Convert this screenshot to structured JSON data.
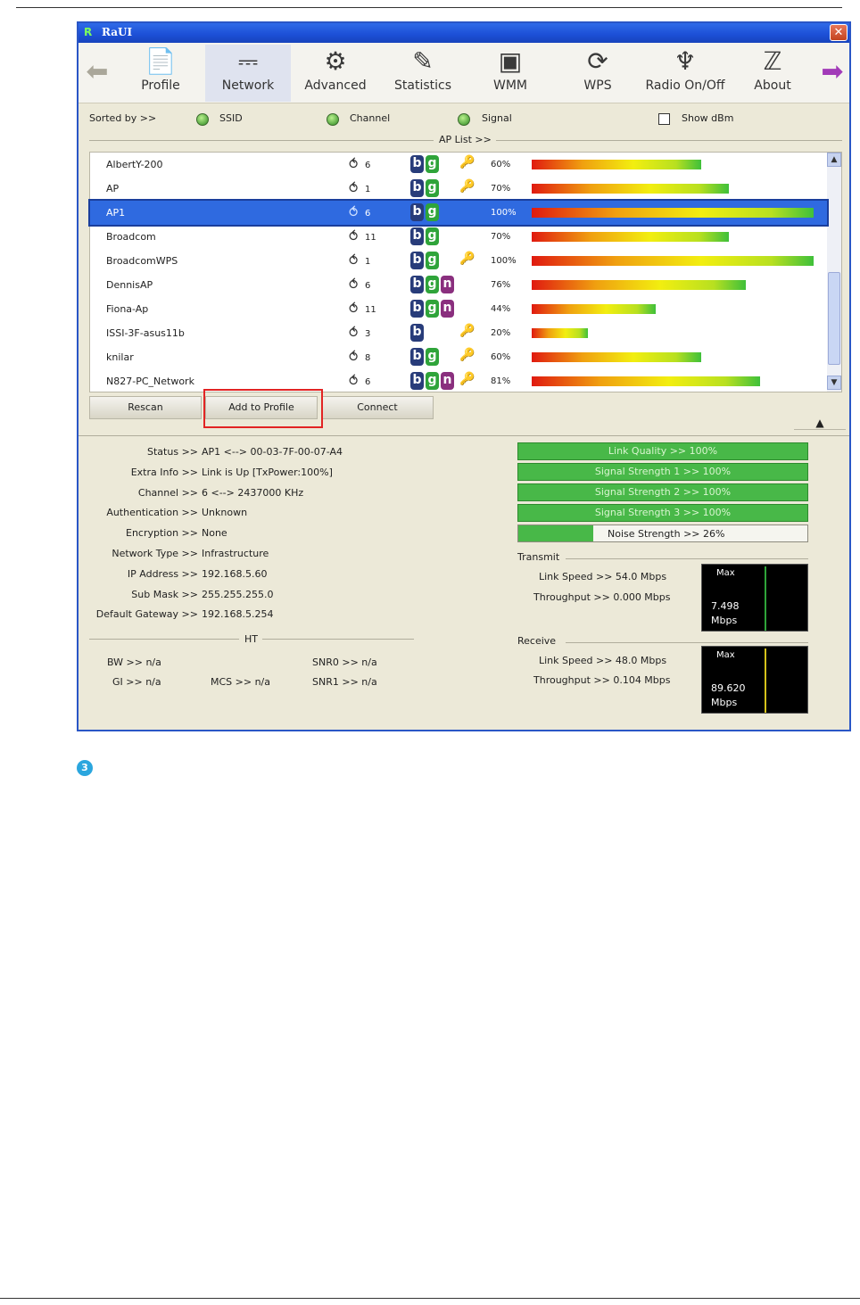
{
  "window": {
    "logo": "R",
    "title": "RaUI",
    "close": "✕"
  },
  "toolbar": {
    "back": "⬅",
    "forward": "➡",
    "items": [
      {
        "label": "Profile",
        "icon": "profile-icon",
        "glyph": "📄",
        "active": false
      },
      {
        "label": "Network",
        "icon": "router-icon",
        "glyph": "⎓",
        "active": true
      },
      {
        "label": "Advanced",
        "icon": "gears-icon",
        "glyph": "⚙",
        "active": false
      },
      {
        "label": "Statistics",
        "icon": "statistics-icon",
        "glyph": "✎",
        "active": false
      },
      {
        "label": "WMM",
        "icon": "wmm-icon",
        "glyph": "▣",
        "active": false
      },
      {
        "label": "WPS",
        "icon": "wps-icon",
        "glyph": "⟳",
        "active": false
      },
      {
        "label": "Radio On/Off",
        "icon": "radio-icon",
        "glyph": "♆",
        "active": false
      },
      {
        "label": "About",
        "icon": "about-icon",
        "glyph": "ℤ",
        "active": false
      }
    ]
  },
  "sort": {
    "label": "Sorted by >>",
    "ssid": "SSID",
    "channel": "Channel",
    "signal": "Signal",
    "show_dbm": "Show dBm",
    "ap_list": "AP List >>"
  },
  "ap_list": [
    {
      "ssid": "AlbertY-200",
      "channel": "6",
      "b": true,
      "g": true,
      "n": false,
      "secured": true,
      "signal": "60%",
      "level": 0.6
    },
    {
      "ssid": "AP",
      "channel": "1",
      "b": true,
      "g": true,
      "n": false,
      "secured": true,
      "signal": "70%",
      "level": 0.7
    },
    {
      "ssid": "AP1",
      "channel": "6",
      "b": true,
      "g": true,
      "n": false,
      "secured": false,
      "signal": "100%",
      "level": 1.0,
      "selected": true
    },
    {
      "ssid": "Broadcom",
      "channel": "11",
      "b": true,
      "g": true,
      "n": false,
      "secured": false,
      "signal": "70%",
      "level": 0.7
    },
    {
      "ssid": "BroadcomWPS",
      "channel": "1",
      "b": true,
      "g": true,
      "n": false,
      "secured": true,
      "signal": "100%",
      "level": 1.0
    },
    {
      "ssid": "DennisAP",
      "channel": "6",
      "b": true,
      "g": true,
      "n": true,
      "secured": false,
      "signal": "76%",
      "level": 0.76
    },
    {
      "ssid": "Fiona-Ap",
      "channel": "11",
      "b": true,
      "g": true,
      "n": true,
      "secured": false,
      "signal": "44%",
      "level": 0.44
    },
    {
      "ssid": "ISSI-3F-asus11b",
      "channel": "3",
      "b": true,
      "g": false,
      "n": false,
      "secured": true,
      "signal": "20%",
      "level": 0.2
    },
    {
      "ssid": "knilar",
      "channel": "8",
      "b": true,
      "g": true,
      "n": false,
      "secured": true,
      "signal": "60%",
      "level": 0.6
    },
    {
      "ssid": "N827-PC_Network",
      "channel": "6",
      "b": true,
      "g": true,
      "n": true,
      "secured": true,
      "signal": "81%",
      "level": 0.81
    }
  ],
  "badges": {
    "b": "b",
    "g": "g",
    "n": "n",
    "lock": "🔑",
    "channel_icon": "⥀"
  },
  "scroll": {
    "up": "▲",
    "down": "▼"
  },
  "buttons": {
    "rescan": "Rescan",
    "add_to_profile": "Add to Profile",
    "connect": "Connect",
    "collapse": "▲"
  },
  "info": [
    {
      "label": "Status >>",
      "value": "AP1 <--> 00-03-7F-00-07-A4"
    },
    {
      "label": "Extra Info >>",
      "value": "Link is Up [TxPower:100%]"
    },
    {
      "label": "Channel >>",
      "value": "6 <--> 2437000 KHz"
    },
    {
      "label": "Authentication >>",
      "value": "Unknown"
    },
    {
      "label": "Encryption >>",
      "value": "None"
    },
    {
      "label": "Network Type >>",
      "value": "Infrastructure"
    },
    {
      "label": "IP Address >>",
      "value": "192.168.5.60"
    },
    {
      "label": "Sub Mask >>",
      "value": "255.255.255.0"
    },
    {
      "label": "Default Gateway >>",
      "value": "192.168.5.254"
    }
  ],
  "ht": {
    "title": "HT",
    "bw": "BW >> n/a",
    "gi": "GI >> n/a",
    "mcs": "MCS >> n/a",
    "snr0": "SNR0 >> n/a",
    "snr1": "SNR1 >> n/a"
  },
  "quality": {
    "bars": [
      "Link Quality >> 100%",
      "Signal Strength 1 >> 100%",
      "Signal Strength 2 >> 100%",
      "Signal Strength 3 >> 100%"
    ],
    "noise": "Noise Strength >> 26%",
    "noise_level": 0.26
  },
  "transmit": {
    "title": "Transmit",
    "link_speed": "Link Speed >> 54.0 Mbps",
    "throughput": "Throughput >> 0.000 Mbps",
    "max": "Max",
    "value": "7.498",
    "unit": "Mbps",
    "trace_color": "#2fa43a"
  },
  "receive": {
    "title": "Receive",
    "link_speed": "Link Speed >> 48.0 Mbps",
    "throughput": "Throughput >> 0.104 Mbps",
    "max": "Max",
    "value": "89.620",
    "unit": "Mbps",
    "trace_color": "#d6c21a"
  },
  "step": "3"
}
